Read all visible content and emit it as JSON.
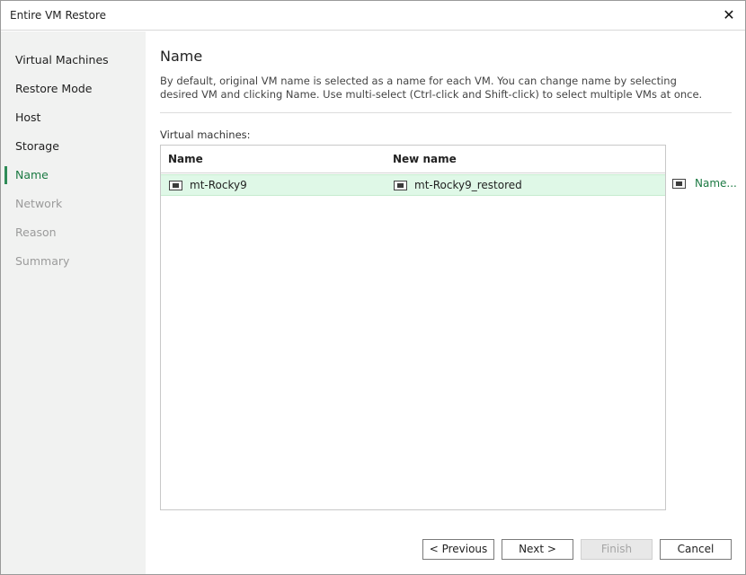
{
  "window": {
    "title": "Entire VM Restore",
    "close_glyph": "✕"
  },
  "sidebar": {
    "items": [
      {
        "label": "Virtual Machines",
        "state": "normal"
      },
      {
        "label": "Restore Mode",
        "state": "normal"
      },
      {
        "label": "Host",
        "state": "normal"
      },
      {
        "label": "Storage",
        "state": "normal"
      },
      {
        "label": "Name",
        "state": "active"
      },
      {
        "label": "Network",
        "state": "disabled"
      },
      {
        "label": "Reason",
        "state": "disabled"
      },
      {
        "label": "Summary",
        "state": "disabled"
      }
    ]
  },
  "main": {
    "title": "Name",
    "description": "By default, original VM name is selected as a name for each VM. You can change name by selecting desired VM and clicking Name. Use multi-select (Ctrl-click and Shift-click) to select multiple VMs at once.",
    "list_label": "Virtual machines:",
    "columns": [
      "Name",
      "New name"
    ],
    "rows": [
      {
        "name": "mt-Rocky9",
        "new_name": "mt-Rocky9_restored",
        "selected": true
      }
    ],
    "name_action_label": "Name..."
  },
  "footer": {
    "previous_label": "< Previous",
    "next_label": "Next >",
    "finish_label": "Finish",
    "cancel_label": "Cancel"
  },
  "colors": {
    "accent": "#1c7a43",
    "selected_row": "#dff8e7",
    "sidebar_bg": "#f1f2f1"
  },
  "icons": {
    "close": "close-icon",
    "vm": "vm-icon"
  }
}
